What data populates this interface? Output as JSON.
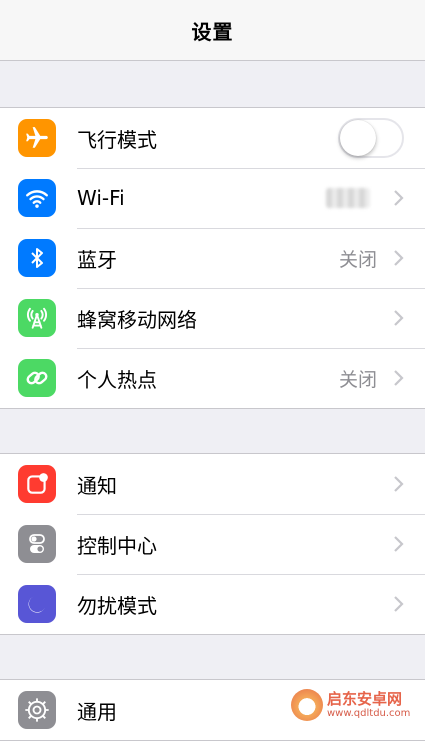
{
  "nav": {
    "title": "设置"
  },
  "groups": [
    {
      "rows": [
        {
          "label": "飞行模式",
          "icon": "airplane-icon",
          "icon_color": "#ff9500",
          "accessory": "toggle",
          "toggle_on": false
        },
        {
          "label": "Wi-Fi",
          "icon": "wifi-icon",
          "icon_color": "#007aff",
          "accessory": "chevron",
          "value": ""
        },
        {
          "label": "蓝牙",
          "icon": "bluetooth-icon",
          "icon_color": "#007aff",
          "accessory": "chevron",
          "value": "关闭"
        },
        {
          "label": "蜂窝移动网络",
          "icon": "cellular-antenna-icon",
          "icon_color": "#4cd964",
          "accessory": "chevron",
          "value": ""
        },
        {
          "label": "个人热点",
          "icon": "hotspot-link-icon",
          "icon_color": "#4cd964",
          "accessory": "chevron",
          "value": "关闭"
        }
      ]
    },
    {
      "rows": [
        {
          "label": "通知",
          "icon": "notification-icon",
          "icon_color": "#ff3b30",
          "accessory": "chevron"
        },
        {
          "label": "控制中心",
          "icon": "control-center-icon",
          "icon_color": "#8e8e93",
          "accessory": "chevron"
        },
        {
          "label": "勿扰模式",
          "icon": "moon-icon",
          "icon_color": "#5856d6",
          "accessory": "chevron"
        }
      ]
    },
    {
      "rows": [
        {
          "label": "通用",
          "icon": "gear-icon",
          "icon_color": "#8e8e93",
          "accessory": "chevron"
        }
      ]
    }
  ],
  "watermark": {
    "text": "启东安卓网",
    "url": "www.qdltdu.com"
  }
}
